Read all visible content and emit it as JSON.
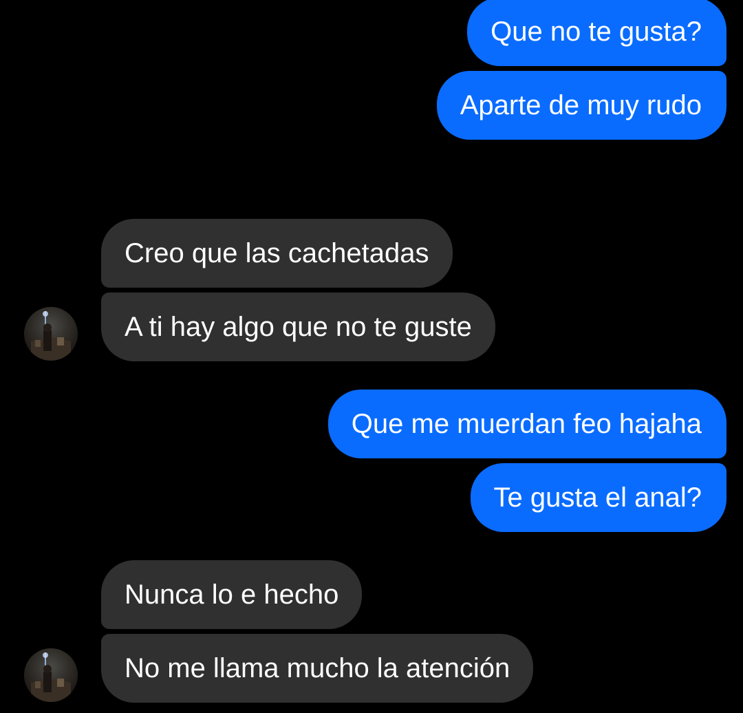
{
  "conversation": {
    "messages": [
      {
        "side": "sent",
        "text": "Que no te gusta?"
      },
      {
        "side": "sent",
        "text": "Aparte de muy rudo"
      },
      {
        "side": "received",
        "text": "Creo que las cachetadas"
      },
      {
        "side": "received",
        "text": "A ti hay algo que no te guste"
      },
      {
        "side": "sent",
        "text": "Que me muerdan feo hajaha"
      },
      {
        "side": "sent",
        "text": "Te gusta el anal?"
      },
      {
        "side": "received",
        "text": "Nunca lo e hecho"
      },
      {
        "side": "received",
        "text": "No me llama mucho la atención"
      }
    ]
  },
  "colors": {
    "background": "#000000",
    "sent_bubble": "#0a6cff",
    "received_bubble": "#303030",
    "text": "#ffffff"
  },
  "icons": {
    "contact_avatar": "contact-avatar-photo"
  }
}
